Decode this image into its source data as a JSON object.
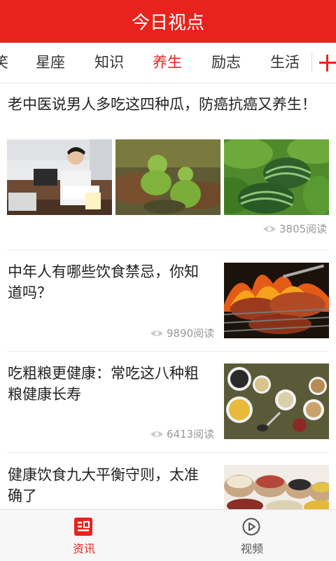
{
  "app": {
    "title": "今日视点"
  },
  "tabs": [
    {
      "label": "笑"
    },
    {
      "label": "星座"
    },
    {
      "label": "知识"
    },
    {
      "label": "养生",
      "active": true
    },
    {
      "label": "励志"
    },
    {
      "label": "生活"
    }
  ],
  "articles": [
    {
      "title": "老中医说男人多吃这四种瓜，防癌抗癌又养生！",
      "views": "3805阅读",
      "images": [
        "doctor-photo",
        "gourd-photo",
        "watermelon-photo"
      ]
    },
    {
      "title": "中年人有哪些饮食禁忌，你知道吗？",
      "views": "9890阅读",
      "images": [
        "bbq-meat-photo"
      ]
    },
    {
      "title": "吃粗粮更健康：常吃这八种粗粮健康长寿",
      "views": "6413阅读",
      "images": [
        "grains-bowls-photo"
      ]
    },
    {
      "title": "健康饮食九大平衡守则，太准确了",
      "views": "",
      "images": [
        "beans-sacks-photo"
      ]
    }
  ],
  "bottom_nav": [
    {
      "label": "资讯",
      "icon": "news-icon",
      "active": true
    },
    {
      "label": "视频",
      "icon": "play-video-icon",
      "active": false
    }
  ],
  "colors": {
    "accent": "#e8231e",
    "text": "#222222",
    "muted": "#999999"
  }
}
